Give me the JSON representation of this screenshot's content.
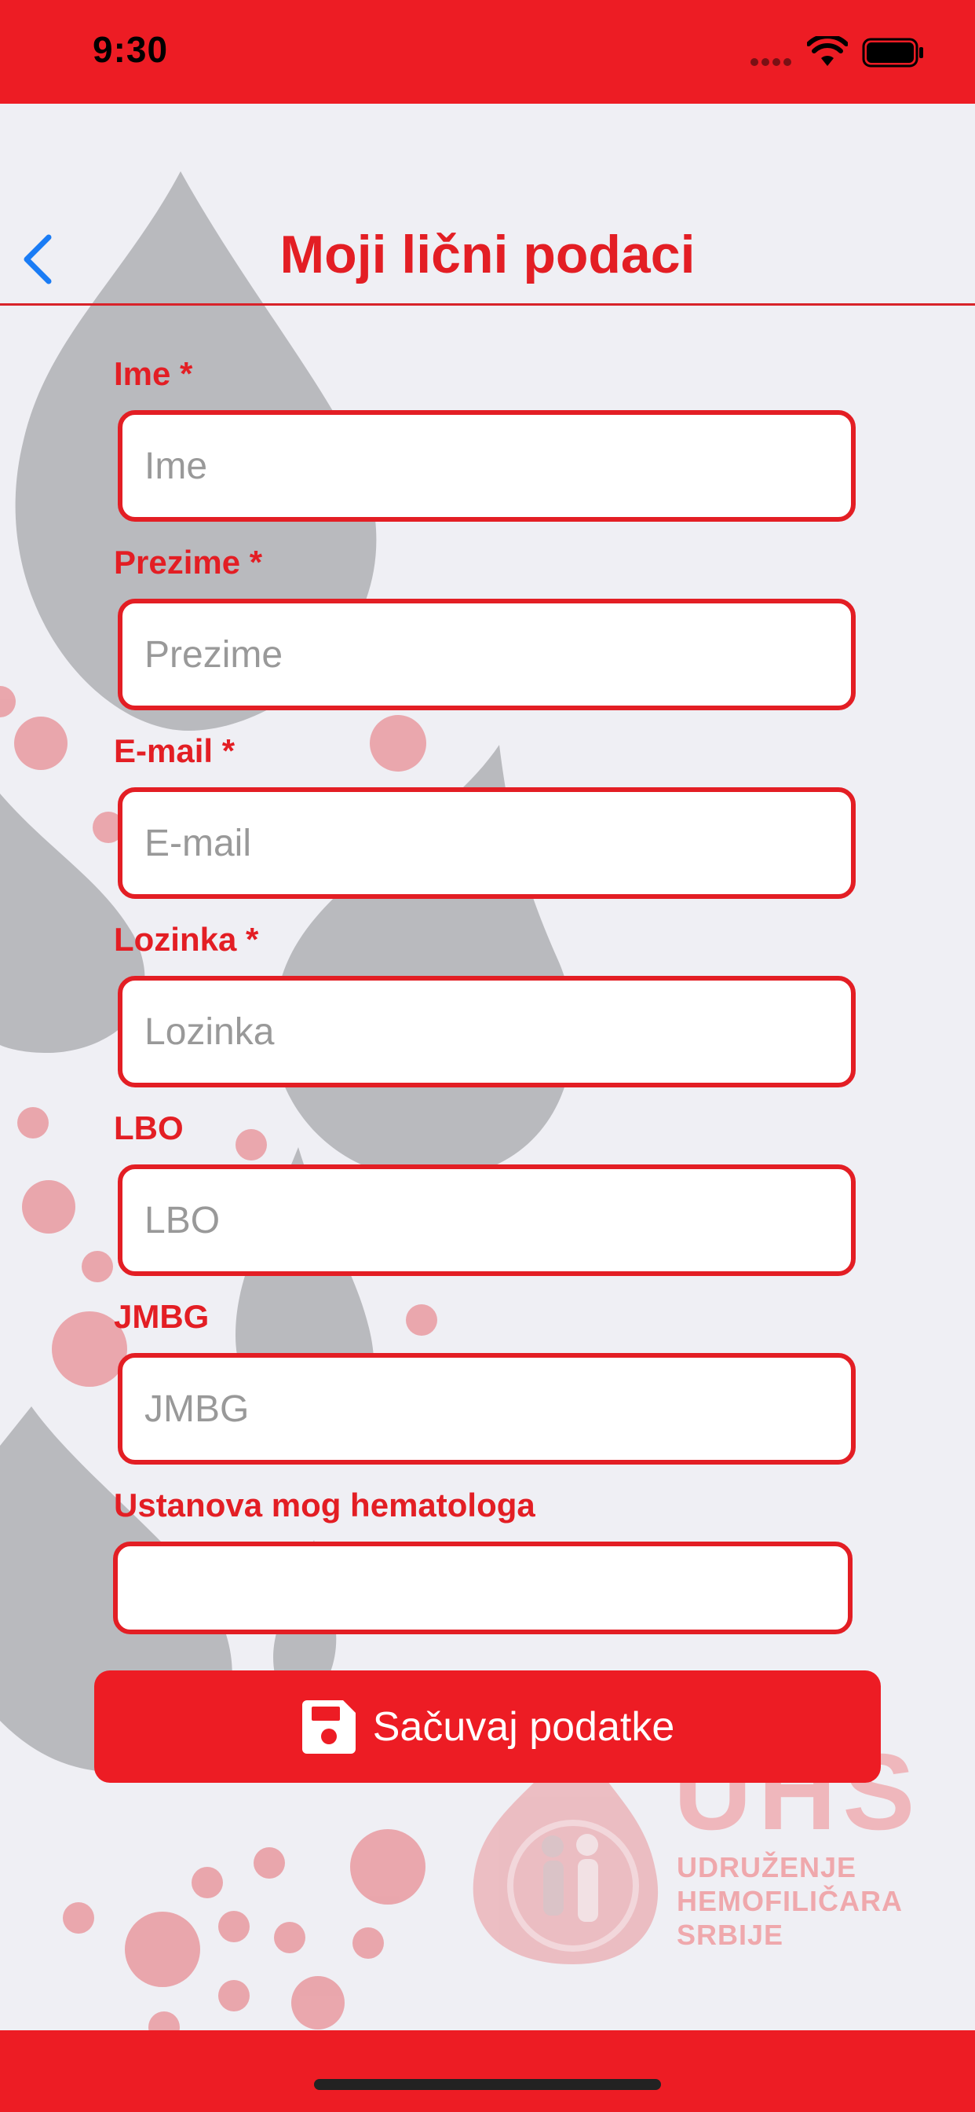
{
  "status_bar": {
    "time": "9:30"
  },
  "nav": {
    "title": "Moji lični podaci"
  },
  "form": {
    "fields": [
      {
        "label": "Ime *",
        "placeholder": "Ime",
        "value": ""
      },
      {
        "label": "Prezime *",
        "placeholder": "Prezime",
        "value": ""
      },
      {
        "label": "E-mail *",
        "placeholder": "E-mail",
        "value": ""
      },
      {
        "label": "Lozinka *",
        "placeholder": "Lozinka",
        "value": ""
      },
      {
        "label": "LBO",
        "placeholder": "LBO",
        "value": ""
      },
      {
        "label": "JMBG",
        "placeholder": "JMBG",
        "value": ""
      }
    ],
    "institution": {
      "label": "Ustanova mog hematologa",
      "value": ""
    },
    "save_label": "Sačuvaj podatke"
  },
  "logo": {
    "abbr": "UHS",
    "line1": "UDRUŽENJE",
    "line2": "HEMOFILIČARA",
    "line3": "SRBIJE"
  },
  "colors": {
    "accent": "#ed1c24",
    "label": "#e31e24",
    "back_arrow": "#1a7cf5",
    "background": "#efeff4"
  },
  "icons": {
    "back": "chevron-left-icon",
    "save": "floppy-disk-icon",
    "wifi": "wifi-icon",
    "battery": "battery-icon",
    "signal": "cellular-signal-icon"
  }
}
